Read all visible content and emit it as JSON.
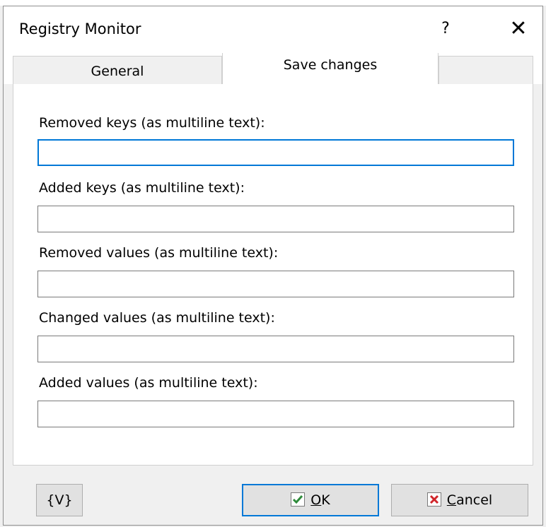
{
  "window": {
    "title": "Registry Monitor",
    "help_glyph": "?",
    "close_glyph": "✕"
  },
  "tabs": [
    {
      "label": "General",
      "active": false
    },
    {
      "label": "Save changes",
      "active": true
    }
  ],
  "fields": [
    {
      "label": "Removed keys (as multiline text):",
      "value": "",
      "focused": true
    },
    {
      "label": "Added keys (as multiline text):",
      "value": ""
    },
    {
      "label": "Removed values (as multiline text):",
      "value": ""
    },
    {
      "label": "Changed values (as multiline text):",
      "value": ""
    },
    {
      "label": "Added values (as multiline text):",
      "value": ""
    }
  ],
  "buttons": {
    "variables_label": "{V}",
    "ok_accel": "O",
    "ok_rest": "K",
    "cancel_accel": "C",
    "cancel_rest": "ancel"
  },
  "icons": {
    "ok_icon": "checkmark-icon",
    "cancel_icon": "x-mark-icon",
    "close_icon": "close-icon"
  },
  "colors": {
    "focus_border": "#0078d7",
    "check_green": "#2e8b3a",
    "x_red": "#d0252a"
  }
}
